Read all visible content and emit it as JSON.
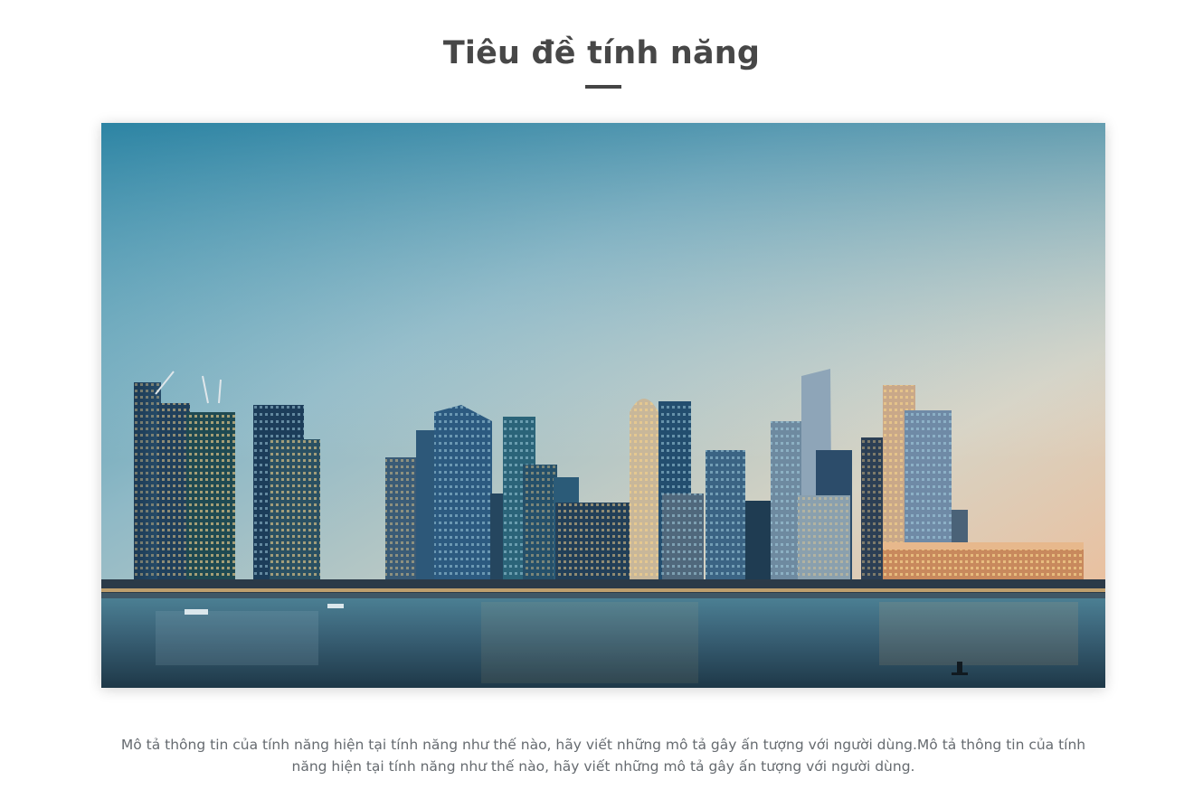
{
  "feature": {
    "title": "Tiêu đề tính năng",
    "description": "Mô tả thông tin của tính năng hiện tại tính năng như thế nào, hãy viết những mô tả gây ấn tượng với người dùng.Mô tả thông tin của tính năng hiện tại tính năng như thế nào, hãy viết những mô tả gây ấn tượng với người dùng."
  },
  "colors": {
    "title": "#474747",
    "underline": "#454545",
    "description": "#666b70"
  }
}
